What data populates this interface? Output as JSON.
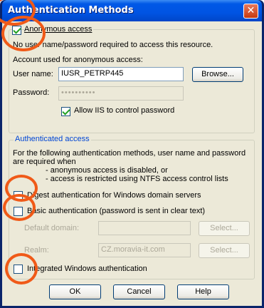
{
  "window": {
    "title": "Authentication Methods",
    "close_glyph": "✕"
  },
  "anonymous": {
    "checkbox_label": "Anonymous access",
    "checked": true,
    "description": "No user name/password required to access this resource.",
    "account_caption": "Account used for anonymous access:",
    "username_label": "User name:",
    "username_value": "IUSR_PETRP445",
    "browse_label": "Browse...",
    "password_label": "Password:",
    "password_value": "••••••••••",
    "allow_iis_label": "Allow IIS to control password",
    "allow_iis_checked": true
  },
  "authenticated": {
    "group_title": "Authenticated access",
    "desc_line1": "For the following authentication methods, user name and password",
    "desc_line2": "are required when",
    "desc_line3": "- anonymous access is disabled, or",
    "desc_line4": "- access is restricted using NTFS access control lists",
    "digest_label": "Digest authentication for Windows domain servers",
    "basic_label": "Basic authentication (password is sent in clear text)",
    "default_domain_label": "Default domain:",
    "default_domain_value": "",
    "realm_label": "Realm:",
    "realm_value": "CZ.moravia-it.com",
    "select_label": "Select...",
    "integrated_label": "Integrated Windows authentication"
  },
  "buttons": {
    "ok": "OK",
    "cancel": "Cancel",
    "help": "Help"
  },
  "colors": {
    "title_blue": "#0054e3",
    "annotation_orange": "#f05a18",
    "group_title": "#0046d5"
  }
}
